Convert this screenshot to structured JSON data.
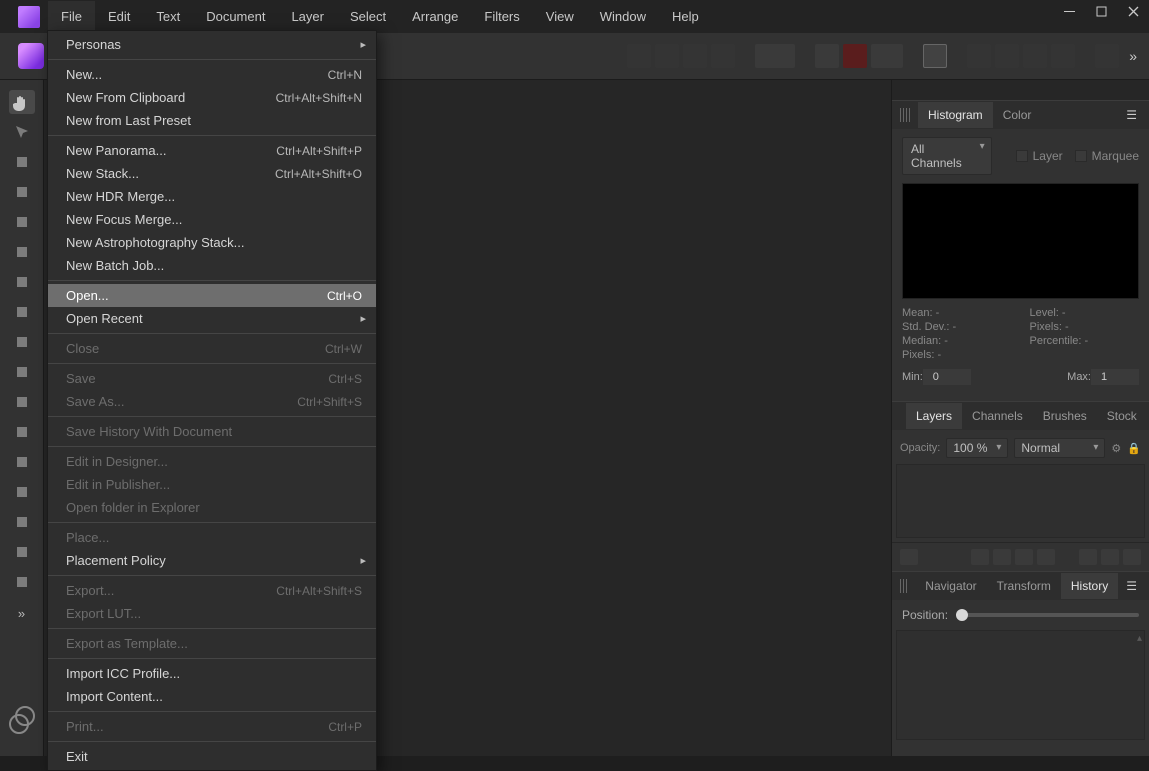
{
  "menubar": [
    "File",
    "Edit",
    "Text",
    "Document",
    "Layer",
    "Select",
    "Arrange",
    "Filters",
    "View",
    "Window",
    "Help"
  ],
  "file_menu": [
    {
      "type": "sub",
      "label": "Personas"
    },
    {
      "type": "sep"
    },
    {
      "type": "item",
      "label": "New...",
      "shortcut": "Ctrl+N"
    },
    {
      "type": "item",
      "label": "New From Clipboard",
      "shortcut": "Ctrl+Alt+Shift+N"
    },
    {
      "type": "item",
      "label": "New from Last Preset"
    },
    {
      "type": "sep"
    },
    {
      "type": "item",
      "label": "New Panorama...",
      "shortcut": "Ctrl+Alt+Shift+P"
    },
    {
      "type": "item",
      "label": "New Stack...",
      "shortcut": "Ctrl+Alt+Shift+O"
    },
    {
      "type": "item",
      "label": "New HDR Merge..."
    },
    {
      "type": "item",
      "label": "New Focus Merge..."
    },
    {
      "type": "item",
      "label": "New Astrophotography Stack..."
    },
    {
      "type": "item",
      "label": "New Batch Job..."
    },
    {
      "type": "sep"
    },
    {
      "type": "item",
      "label": "Open...",
      "shortcut": "Ctrl+O",
      "hover": true
    },
    {
      "type": "sub",
      "label": "Open Recent"
    },
    {
      "type": "sep"
    },
    {
      "type": "item",
      "label": "Close",
      "shortcut": "Ctrl+W",
      "disabled": true
    },
    {
      "type": "sep"
    },
    {
      "type": "item",
      "label": "Save",
      "shortcut": "Ctrl+S",
      "disabled": true
    },
    {
      "type": "item",
      "label": "Save As...",
      "shortcut": "Ctrl+Shift+S",
      "disabled": true
    },
    {
      "type": "sep"
    },
    {
      "type": "item",
      "label": "Save History With Document",
      "disabled": true
    },
    {
      "type": "sep"
    },
    {
      "type": "item",
      "label": "Edit in Designer...",
      "disabled": true
    },
    {
      "type": "item",
      "label": "Edit in Publisher...",
      "disabled": true
    },
    {
      "type": "item",
      "label": "Open folder in Explorer",
      "disabled": true
    },
    {
      "type": "sep"
    },
    {
      "type": "item",
      "label": "Place...",
      "disabled": true
    },
    {
      "type": "sub",
      "label": "Placement Policy"
    },
    {
      "type": "sep"
    },
    {
      "type": "item",
      "label": "Export...",
      "shortcut": "Ctrl+Alt+Shift+S",
      "disabled": true
    },
    {
      "type": "item",
      "label": "Export LUT...",
      "disabled": true
    },
    {
      "type": "sep"
    },
    {
      "type": "item",
      "label": "Export as Template...",
      "disabled": true
    },
    {
      "type": "sep"
    },
    {
      "type": "item",
      "label": "Import ICC Profile..."
    },
    {
      "type": "item",
      "label": "Import Content..."
    },
    {
      "type": "sep"
    },
    {
      "type": "item",
      "label": "Print...",
      "shortcut": "Ctrl+P",
      "disabled": true
    },
    {
      "type": "sep"
    },
    {
      "type": "item",
      "label": "Exit"
    }
  ],
  "tools": [
    "hand-tool",
    "move-tool",
    "selection-brush-tool",
    "crop-tool",
    "paint-brush-tool",
    "marquee-tool",
    "flood-select-tool",
    "heal-brush-tool",
    "clone-tool",
    "erase-tool",
    "dodge-tool",
    "gradient-tool",
    "smudge-tool",
    "blur-tool",
    "sponge-tool",
    "zoom-tool",
    "color-picker-tool"
  ],
  "histogram": {
    "tab1": "Histogram",
    "tab2": "Color",
    "channels": "All Channels",
    "layer": "Layer",
    "marquee": "Marquee",
    "stats": {
      "mean": "Mean: -",
      "level": "Level: -",
      "stddev": "Std. Dev.: -",
      "pixels_r": "Pixels: -",
      "median": "Median: -",
      "percentile": "Percentile: -",
      "pixels_l": "Pixels: -"
    },
    "min_label": "Min:",
    "min_val": "0",
    "max_label": "Max:",
    "max_val": "1"
  },
  "layers": {
    "tabs": [
      "Layers",
      "Channels",
      "Brushes",
      "Stock"
    ],
    "opacity_label": "Opacity:",
    "opacity_val": "100 %",
    "blend": "Normal"
  },
  "bottom": {
    "tabs": [
      "Navigator",
      "Transform",
      "History"
    ],
    "position_label": "Position:"
  }
}
